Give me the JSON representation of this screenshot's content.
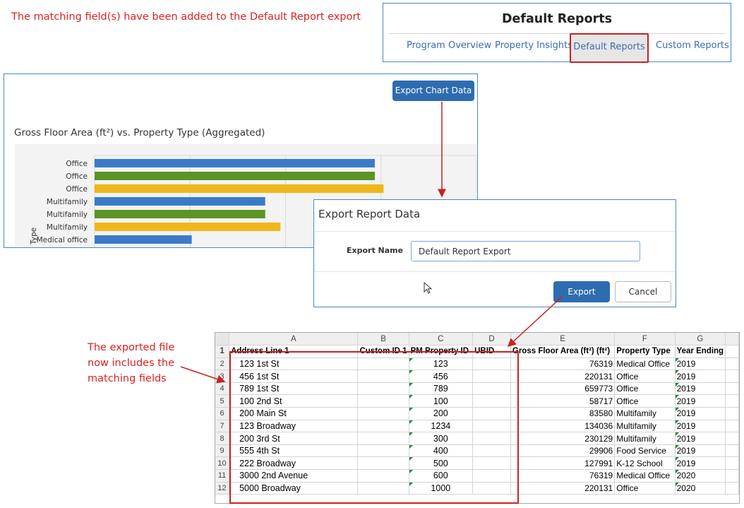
{
  "annotations": {
    "top_note": "The matching field(s) have been added to the Default Report export",
    "left_note": "The exported file now includes the matching fields"
  },
  "reports_panel": {
    "title": "Default Reports",
    "tabs": [
      "Program Overview",
      "Property Insights",
      "Default Reports",
      "Custom Reports"
    ],
    "active_tab": "Default Reports"
  },
  "chart_panel": {
    "export_button": "Export Chart Data",
    "chart_title": "Gross Floor Area (ft²) vs. Property Type (Aggregated)",
    "y_axis_label": "Type"
  },
  "chart_data": {
    "type": "bar",
    "orientation": "horizontal",
    "title": "Gross Floor Area (ft²) vs. Property Type (Aggregated)",
    "ylabel": "Type",
    "categories": [
      "Office",
      "Office",
      "Office",
      "Multifamily",
      "Multifamily",
      "Multifamily",
      "Medical office"
    ],
    "values": [
      220131,
      220131,
      227000,
      134036,
      134036,
      146000,
      76319
    ],
    "bar_colors": [
      "#3a7bc8",
      "#5c9426",
      "#efb71b",
      "#3a7bc8",
      "#5c9426",
      "#efb71b",
      "#3a7bc8"
    ],
    "grid": true
  },
  "export_dialog": {
    "title": "Export Report Data",
    "name_label": "Export Name",
    "name_value": "Default Report Export",
    "export_button": "Export",
    "cancel_button": "Cancel"
  },
  "spreadsheet": {
    "column_letters": [
      "A",
      "B",
      "C",
      "D",
      "E",
      "F",
      "G"
    ],
    "headers": [
      "Address Line 1",
      "Custom ID 1",
      "PM Property ID",
      "UBID",
      "Gross Floor Area (ft²) (ft²)",
      "Property Type",
      "Year Ending"
    ],
    "rows": [
      [
        "123 1st St",
        "",
        "123",
        "",
        "76319",
        "Medical Office",
        "2019"
      ],
      [
        "456 1st St",
        "",
        "456",
        "",
        "220131",
        "Office",
        "2019"
      ],
      [
        "789 1st St",
        "",
        "789",
        "",
        "659773",
        "Office",
        "2019"
      ],
      [
        "100 2nd St",
        "",
        "100",
        "",
        "58717",
        "Office",
        "2019"
      ],
      [
        "200 Main St",
        "",
        "200",
        "",
        "83580",
        "Multifamily",
        "2019"
      ],
      [
        "123 Broadway",
        "",
        "1234",
        "",
        "134036",
        "Multifamily",
        "2019"
      ],
      [
        "200 3rd St",
        "",
        "300",
        "",
        "230129",
        "Multifamily",
        "2019"
      ],
      [
        "555 4th St",
        "",
        "400",
        "",
        "29906",
        "Food Service",
        "2019"
      ],
      [
        "222 Broadway",
        "",
        "500",
        "",
        "127991",
        "K-12 School",
        "2019"
      ],
      [
        "3000 2nd Avenue",
        "",
        "600",
        "",
        "76319",
        "Medical Office",
        "2020"
      ],
      [
        "5000 Broadway",
        "",
        "1000",
        "",
        "220131",
        "Office",
        "2020"
      ]
    ]
  },
  "colors": {
    "annotation_red": "#e02020",
    "primary_blue": "#2e6cb0",
    "link_blue": "#3b6db3",
    "excel_flag_green": "#1f8a3c"
  }
}
